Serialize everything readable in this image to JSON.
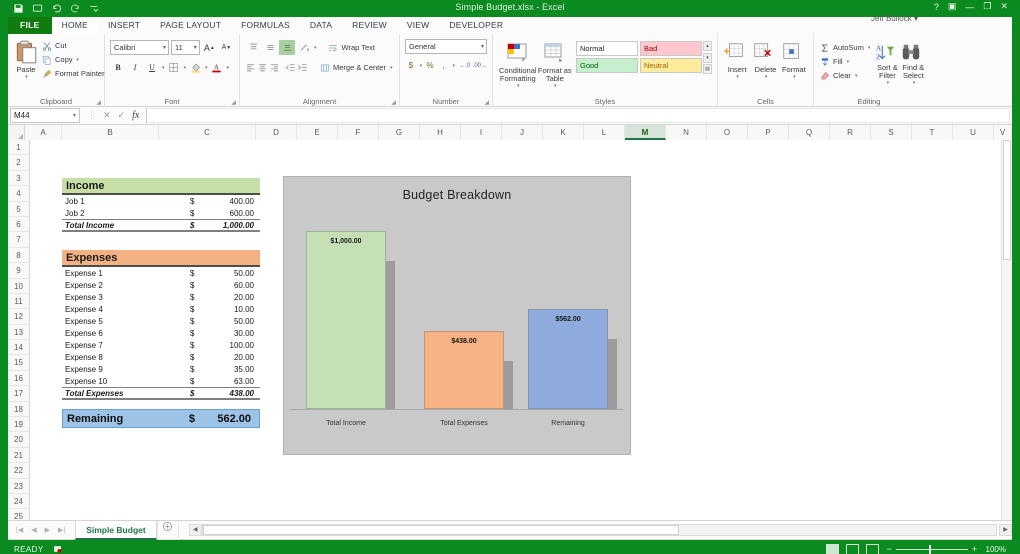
{
  "window": {
    "title": "Simple Budget.xlsx - Excel",
    "user": "Jeff Bullock",
    "qat": [
      "save-icon",
      "undo-icon",
      "redo-icon",
      "touch-mode-icon",
      "customize-icon"
    ],
    "controls": {
      "help": "?",
      "ribbon_options": "▣",
      "minimize": "—",
      "restore": "❐",
      "close": "✕"
    }
  },
  "ribbon": {
    "file_tab": "FILE",
    "tabs": [
      "HOME",
      "INSERT",
      "PAGE LAYOUT",
      "FORMULAS",
      "DATA",
      "REVIEW",
      "VIEW",
      "DEVELOPER"
    ],
    "active_tab": "HOME",
    "groups": {
      "clipboard": {
        "label": "Clipboard",
        "paste": "Paste",
        "cut": "Cut",
        "copy": "Copy",
        "format_painter": "Format Painter"
      },
      "font": {
        "label": "Font",
        "font_name": "Calibri",
        "font_size": "11",
        "grow": "A",
        "shrink": "A",
        "bold": "B",
        "italic": "I",
        "underline": "U",
        "borders": "borders-icon",
        "fill_color": "fill-color-icon",
        "font_color": "A"
      },
      "alignment": {
        "label": "Alignment",
        "wrap_text": "Wrap Text",
        "merge_center": "Merge & Center"
      },
      "number": {
        "label": "Number",
        "format": "General",
        "currency": "$",
        "percent": "%",
        "comma": ",",
        "inc_dec": ".00",
        "dec_dec": ".00"
      },
      "styles": {
        "label": "Styles",
        "conditional_formatting": "Conditional Formatting",
        "format_as_table": "Format as Table",
        "cells": [
          "Normal",
          "Bad",
          "Good",
          "Neutral"
        ]
      },
      "cells": {
        "label": "Cells",
        "insert": "Insert",
        "delete": "Delete",
        "format": "Format"
      },
      "editing": {
        "label": "Editing",
        "autosum": "AutoSum",
        "fill": "Fill",
        "clear": "Clear",
        "sort_filter": "Sort & Filter",
        "find_select": "Find & Select"
      }
    }
  },
  "formula_bar": {
    "name_box": "M44",
    "cancel": "✕",
    "enter": "✓",
    "fx": "fx",
    "value": ""
  },
  "grid": {
    "columns": [
      "A",
      "B",
      "C",
      "D",
      "E",
      "F",
      "G",
      "H",
      "I",
      "J",
      "K",
      "L",
      "M",
      "N",
      "O",
      "P",
      "Q",
      "R",
      "S",
      "T",
      "U",
      "V"
    ],
    "selected_column": "M",
    "rows": [
      "1",
      "2",
      "3",
      "4",
      "5",
      "6",
      "7",
      "8",
      "9",
      "10",
      "11",
      "12",
      "13",
      "14",
      "15",
      "16",
      "17",
      "18",
      "19",
      "20",
      "21",
      "22",
      "23",
      "24",
      "25"
    ]
  },
  "budget": {
    "income": {
      "header": "Income",
      "rows": [
        {
          "name": "Job 1",
          "currency": "$",
          "amount": "400.00"
        },
        {
          "name": "Job 2",
          "currency": "$",
          "amount": "600.00"
        }
      ],
      "total": {
        "name": "Total Income",
        "currency": "$",
        "amount": "1,000.00"
      }
    },
    "expenses": {
      "header": "Expenses",
      "rows": [
        {
          "name": "Expense 1",
          "currency": "$",
          "amount": "50.00"
        },
        {
          "name": "Expense 2",
          "currency": "$",
          "amount": "60.00"
        },
        {
          "name": "Expense 3",
          "currency": "$",
          "amount": "20.00"
        },
        {
          "name": "Expense 4",
          "currency": "$",
          "amount": "10.00"
        },
        {
          "name": "Expense 5",
          "currency": "$",
          "amount": "50.00"
        },
        {
          "name": "Expense 6",
          "currency": "$",
          "amount": "30.00"
        },
        {
          "name": "Expense 7",
          "currency": "$",
          "amount": "100.00"
        },
        {
          "name": "Expense 8",
          "currency": "$",
          "amount": "20.00"
        },
        {
          "name": "Expense 9",
          "currency": "$",
          "amount": "35.00"
        },
        {
          "name": "Expense 10",
          "currency": "$",
          "amount": "63.00"
        }
      ],
      "total": {
        "name": "Total Expenses",
        "currency": "$",
        "amount": "438.00"
      }
    },
    "remaining": {
      "name": "Remaining",
      "currency": "$",
      "amount": "562.00"
    }
  },
  "chart_data": {
    "type": "bar",
    "title": "Budget Breakdown",
    "categories": [
      "Total Income",
      "Total Expenses",
      "Remaining"
    ],
    "values": [
      1000,
      438,
      562
    ],
    "data_labels": [
      "$1,000.00",
      "$438.00",
      "$562.00"
    ],
    "colors": [
      "#c5e0b4",
      "#f8b183",
      "#8faadc"
    ],
    "xlabel": "",
    "ylabel": "",
    "ylim": [
      0,
      1000
    ],
    "grid": false,
    "legend": "none",
    "plot_background": "#c9c9c9"
  },
  "sheet_tabs": {
    "first": "|◀",
    "prev": "◀",
    "next": "▶",
    "last": "▶|",
    "tabs": [
      "Simple Budget"
    ],
    "active": "Simple Budget",
    "add_sheet": "+"
  },
  "status_bar": {
    "status": "READY",
    "macro_icon": "record-macro-icon",
    "views": [
      "normal-view",
      "page-layout-view",
      "page-break-view"
    ],
    "zoom_out": "−",
    "zoom_in": "+",
    "zoom": "100%"
  }
}
